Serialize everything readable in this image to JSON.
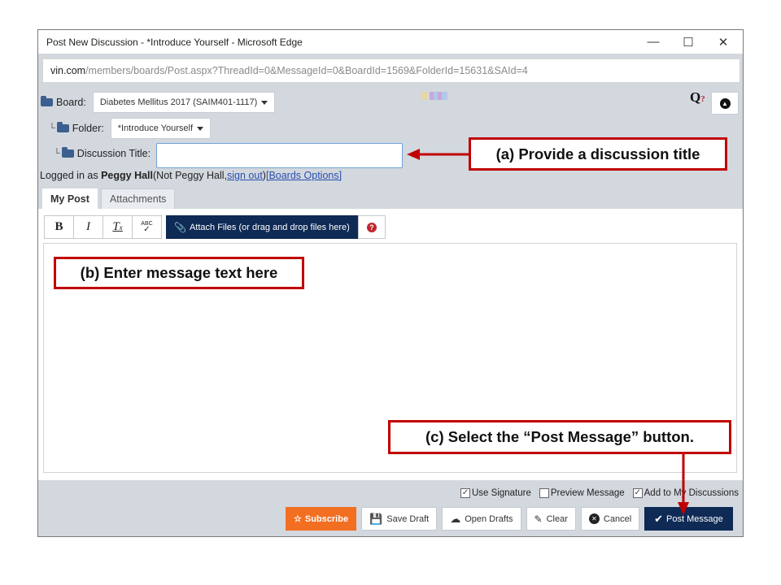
{
  "window": {
    "title": "Post New Discussion - *Introduce Yourself - Microsoft Edge",
    "url_host": "vin.com",
    "url_path": "/members/boards/Post.aspx?ThreadId=0&MessageId=0&BoardId=1569&FolderId=15631&SAId=4"
  },
  "form": {
    "board_label": "Board:",
    "board_value": "Diabetes Mellitus 2017 (SAIM401-1117)",
    "folder_label": "Folder:",
    "folder_value": "*Introduce Yourself",
    "title_label": "Discussion Title:",
    "title_value": "",
    "logged_in_prefix": "Logged in as ",
    "user_name": "Peggy Hall",
    "not_user_prefix": " (Not Peggy Hall, ",
    "sign_out": "sign out",
    "not_user_suffix": ") ",
    "boards_options": "[Boards Options]"
  },
  "tabs": [
    "My Post",
    "Attachments"
  ],
  "toolbar": {
    "bold": "B",
    "italic": "I",
    "clear_format": "T",
    "spell": "ABC",
    "attach": "Attach Files (or drag and drop files here)"
  },
  "options": {
    "use_signature": "Use Signature",
    "preview_message": "Preview Message",
    "add_to_discussions": "Add to My Discussions"
  },
  "buttons": {
    "subscribe": "Subscribe",
    "save_draft": "Save Draft",
    "open_drafts": "Open Drafts",
    "clear": "Clear",
    "cancel": "Cancel",
    "post_message": "Post Message"
  },
  "callouts": {
    "a": "(a) Provide a discussion title",
    "b": "(b) Enter message text here",
    "c": "(c) Select the “Post Message” button."
  },
  "colors": {
    "annotation_red": "#c00000",
    "navy": "#0e2a55",
    "subscribe_orange": "#f26f21"
  }
}
